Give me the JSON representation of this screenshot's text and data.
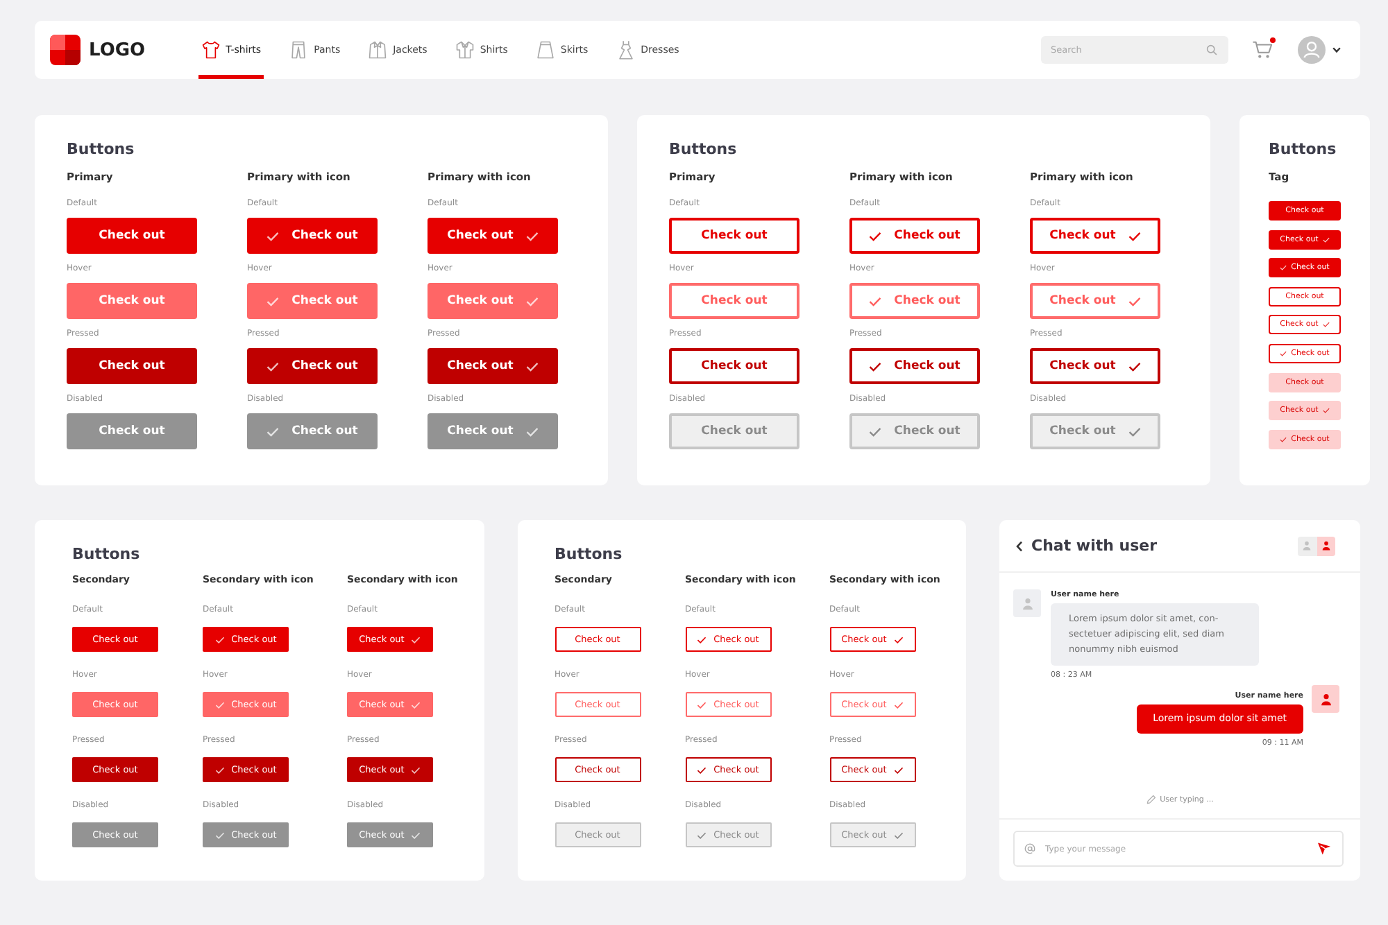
{
  "header": {
    "logo": "LOGO",
    "nav": [
      {
        "kind": "tshirt",
        "label": "T-shirts",
        "selected": true
      },
      {
        "kind": "pants",
        "label": "Pants",
        "selected": false
      },
      {
        "kind": "jacket",
        "label": "Jackets",
        "selected": false
      },
      {
        "kind": "shirt",
        "label": "Shirts",
        "selected": false
      },
      {
        "kind": "skirt",
        "label": "Skirts",
        "selected": false
      },
      {
        "kind": "dress",
        "label": "Dresses",
        "selected": false
      }
    ],
    "search": {
      "placeholder": "Search"
    },
    "cart": {
      "notification": true
    }
  },
  "top_row": [
    {
      "kind": "filled_large",
      "title": "Buttons",
      "columns": [
        {
          "heading": "Primary",
          "kind": "plain",
          "rows": [
            {
              "kind": "default",
              "caption": "Default",
              "label": "Check out"
            },
            {
              "kind": "hover",
              "caption": "Hover",
              "label": "Check out"
            },
            {
              "kind": "pressed",
              "caption": "Pressed",
              "label": "Check out"
            },
            {
              "kind": "disabled",
              "caption": "Disabled",
              "label": "Check out"
            }
          ]
        },
        {
          "heading": "Primary with icon",
          "kind": "icon_left",
          "rows": [
            {
              "kind": "default",
              "caption": "Default",
              "label": "Check out"
            },
            {
              "kind": "hover",
              "caption": "Hover",
              "label": "Check out"
            },
            {
              "kind": "pressed",
              "caption": "Pressed",
              "label": "Check out"
            },
            {
              "kind": "disabled",
              "caption": "Disabled",
              "label": "Check out"
            }
          ]
        },
        {
          "heading": "Primary with icon",
          "kind": "icon_right",
          "rows": [
            {
              "kind": "default",
              "caption": "Default",
              "label": "Check out"
            },
            {
              "kind": "hover",
              "caption": "Hover",
              "label": "Check out"
            },
            {
              "kind": "pressed",
              "caption": "Pressed",
              "label": "Check out"
            },
            {
              "kind": "disabled",
              "caption": "Disabled",
              "label": "Check out"
            }
          ]
        }
      ]
    },
    {
      "kind": "outline_large",
      "title": "Buttons",
      "columns": [
        {
          "heading": "Primary",
          "kind": "plain",
          "rows": [
            {
              "kind": "default",
              "caption": "Default",
              "label": "Check out"
            },
            {
              "kind": "hover",
              "caption": "Hover",
              "label": "Check out"
            },
            {
              "kind": "pressed",
              "caption": "Pressed",
              "label": "Check out"
            },
            {
              "kind": "disabled",
              "caption": "Disabled",
              "label": "Check out"
            }
          ]
        },
        {
          "heading": "Primary with icon",
          "kind": "icon_left",
          "rows": [
            {
              "kind": "default",
              "caption": "Default",
              "label": "Check out"
            },
            {
              "kind": "hover",
              "caption": "Hover",
              "label": "Check out"
            },
            {
              "kind": "pressed",
              "caption": "Pressed",
              "label": "Check out"
            },
            {
              "kind": "disabled",
              "caption": "Disabled",
              "label": "Check out"
            }
          ]
        },
        {
          "heading": "Primary with icon",
          "kind": "icon_right",
          "rows": [
            {
              "kind": "default",
              "caption": "Default",
              "label": "Check out"
            },
            {
              "kind": "hover",
              "caption": "Hover",
              "label": "Check out"
            },
            {
              "kind": "pressed",
              "caption": "Pressed",
              "label": "Check out"
            },
            {
              "kind": "disabled",
              "caption": "Disabled",
              "label": "Check out"
            }
          ]
        }
      ]
    },
    {
      "kind": "tags",
      "title": "Buttons",
      "heading": "Tag",
      "tags": [
        {
          "kind": "filled",
          "label": "Check out"
        },
        {
          "kind": "filled_icon_right",
          "label": "Check out"
        },
        {
          "kind": "filled_icon_left",
          "label": "Check out"
        },
        {
          "kind": "outline",
          "label": "Check out"
        },
        {
          "kind": "outline_icon_right",
          "label": "Check out"
        },
        {
          "kind": "outline_icon_left",
          "label": "Check out"
        },
        {
          "kind": "soft",
          "label": "Check out"
        },
        {
          "kind": "soft_icon_right",
          "label": "Check out"
        },
        {
          "kind": "soft_icon_left",
          "label": "Check out"
        }
      ]
    }
  ],
  "bottom_row": [
    {
      "kind": "filled_small",
      "title": "Buttons",
      "columns": [
        {
          "heading": "Secondary",
          "kind": "plain",
          "rows": [
            {
              "kind": "default",
              "caption": "Default",
              "label": "Check out"
            },
            {
              "kind": "hover",
              "caption": "Hover",
              "label": "Check out"
            },
            {
              "kind": "pressed",
              "caption": "Pressed",
              "label": "Check out"
            },
            {
              "kind": "disabled",
              "caption": "Disabled",
              "label": "Check out"
            }
          ]
        },
        {
          "heading": "Secondary with icon",
          "kind": "icon_left",
          "rows": [
            {
              "kind": "default",
              "caption": "Default",
              "label": "Check out"
            },
            {
              "kind": "hover",
              "caption": "Hover",
              "label": "Check out"
            },
            {
              "kind": "pressed",
              "caption": "Pressed",
              "label": "Check out"
            },
            {
              "kind": "disabled",
              "caption": "Disabled",
              "label": "Check out"
            }
          ]
        },
        {
          "heading": "Secondary with icon",
          "kind": "icon_right",
          "rows": [
            {
              "kind": "default",
              "caption": "Default",
              "label": "Check out"
            },
            {
              "kind": "hover",
              "caption": "Hover",
              "label": "Check out"
            },
            {
              "kind": "pressed",
              "caption": "Pressed",
              "label": "Check out"
            },
            {
              "kind": "disabled",
              "caption": "Disabled",
              "label": "Check out"
            }
          ]
        }
      ]
    },
    {
      "kind": "outline_small",
      "title": "Buttons",
      "columns": [
        {
          "heading": "Secondary",
          "kind": "plain",
          "rows": [
            {
              "kind": "default",
              "caption": "Default",
              "label": "Check out"
            },
            {
              "kind": "hover",
              "caption": "Hover",
              "label": "Check out"
            },
            {
              "kind": "pressed",
              "caption": "Pressed",
              "label": "Check out"
            },
            {
              "kind": "disabled",
              "caption": "Disabled",
              "label": "Check out"
            }
          ]
        },
        {
          "heading": "Secondary with icon",
          "kind": "icon_left",
          "rows": [
            {
              "kind": "default",
              "caption": "Default",
              "label": "Check out"
            },
            {
              "kind": "hover",
              "caption": "Hover",
              "label": "Check out"
            },
            {
              "kind": "pressed",
              "caption": "Pressed",
              "label": "Check out"
            },
            {
              "kind": "disabled",
              "caption": "Disabled",
              "label": "Check out"
            }
          ]
        },
        {
          "heading": "Secondary with icon",
          "kind": "icon_right",
          "rows": [
            {
              "kind": "default",
              "caption": "Default",
              "label": "Check out"
            },
            {
              "kind": "hover",
              "caption": "Hover",
              "label": "Check out"
            },
            {
              "kind": "pressed",
              "caption": "Pressed",
              "label": "Check out"
            },
            {
              "kind": "disabled",
              "caption": "Disabled",
              "label": "Check out"
            }
          ]
        }
      ]
    },
    {
      "kind": "chat",
      "title": "Chat with user",
      "view_toggle": [
        {
          "selected": false
        },
        {
          "selected": true
        }
      ],
      "messages": [
        {
          "kind": "incoming",
          "author": "User name here",
          "text": "Lorem ipsum dolor sit amet, con-sectetuer adipiscing elit, sed diam nonummy nibh euismod",
          "time": "08 : 23 AM"
        },
        {
          "kind": "outgoing",
          "author": "User name here",
          "text": "Lorem ipsum dolor sit amet",
          "time": "09 : 11 AM"
        }
      ],
      "typing": "User typing ...",
      "composer": {
        "placeholder": "Type your message"
      }
    }
  ]
}
